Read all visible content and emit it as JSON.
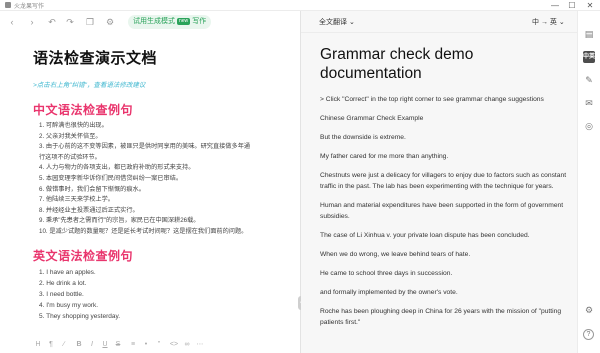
{
  "window": {
    "title": "火龙果写作",
    "minimize": "—",
    "maximize": "☐",
    "close": "✕"
  },
  "left_toolbar": {
    "icons": [
      "back",
      "forward",
      "undo",
      "redo",
      "copy",
      "settings"
    ],
    "mode_label": "试用生成模式",
    "mode_badge": "new",
    "mode_suffix": "写作"
  },
  "left_doc": {
    "title": "语法检查演示文档",
    "hint": ">点击右上角\"纠错\"，查看语法修改建议",
    "cn_heading": "中文语法检查例句",
    "cn_items": [
      "1. 可醉满也很快的出现。",
      "2. 父亲对我关怀倍至。",
      "3. 由于心前的这不变等因素，被匪只是供时同享用的美味。研究直接做多年通",
      "   行这项不的试验环节。",
      "4. 人力与物力的各项支出，都已政府补助的形式来支持。",
      "5. 本园变理李新华诉你们民间借贷纠纷一案已审结。",
      "6. 做错事时，我们会留下惭慨的痕水。",
      "7. 他陆续三天来学校上学。",
      "8. 并经经业主投票通过后正式实行。",
      "9. 秉承\"先患者之需而行\"的宗旨，家民已在中国深耕26载。",
      "10. 是减少试题的数量呢？还是延长考试时间呢？这是摆在我们面前的问题。"
    ],
    "en_heading": "英文语法检查例句",
    "en_items": [
      "1. I have an apples.",
      "2. He drink a lot.",
      "3. I need bottle.",
      "4. I'm busy my work.",
      "5. They shopping yesterday."
    ]
  },
  "format_bar": {
    "icons": [
      "H",
      "B",
      "I",
      "U",
      "S",
      "ol",
      "ul",
      "quote",
      "code",
      "link",
      "more"
    ]
  },
  "right_header": {
    "translate_label": "全文翻译 ⌄",
    "lang_label": "中 → 英 ⌄"
  },
  "right_doc": {
    "title": "Grammar check demo documentation",
    "paragraphs": [
      "> Click \"Correct\" in the top right corner to see grammar change suggestions",
      "Chinese Grammar Check Example",
      "But the downside is extreme.",
      "My father cared for me more than anything.",
      "Chestnuts were just a delicacy for villagers to enjoy due to factors such as constant traffic in the past. The lab has been experimenting with the technique for years.",
      "Human and material expenditures have been supported in the form of government subsidies.",
      "The case of Li Xinhua v. your private loan dispute has been concluded.",
      "When we do wrong, we leave behind tears of hate.",
      "He came to school three days in succession.",
      "and formally implemented by the owner's vote.",
      "Roche has been ploughing deep in China for 26 years with the mission of \"putting patients first.\""
    ]
  },
  "sidebar": {
    "icons": [
      "document-icon",
      "translate-icon",
      "polish-icon",
      "mail-icon",
      "compass-icon",
      "settings-icon",
      "help-icon"
    ],
    "active_label": "中英",
    "help_label": "?"
  }
}
